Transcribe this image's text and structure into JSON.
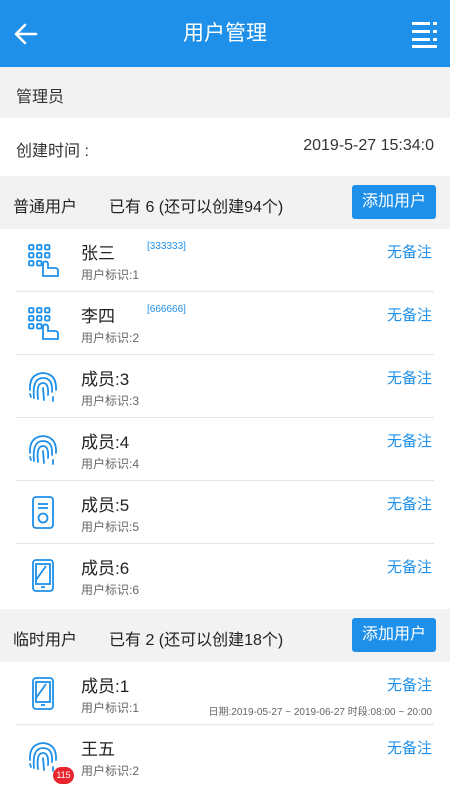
{
  "header": {
    "title": "用户管理",
    "back_icon": "arrow-left-icon",
    "menu_icon": "list-menu-icon"
  },
  "admin": {
    "label": "管理员"
  },
  "creation": {
    "label": "创建时间 :",
    "value": "2019-5-27 15:34:0"
  },
  "regular": {
    "title": "普通用户",
    "count_text": "已有 6 (还可以创建94个)",
    "add_label": "添加用户",
    "users": [
      {
        "name": "张三",
        "code": "[333333]",
        "uid": "用户标识:1",
        "note": "无备注",
        "icon": "keypad-icon"
      },
      {
        "name": "李四",
        "code": "[666666]",
        "uid": "用户标识:2",
        "note": "无备注",
        "icon": "keypad-icon"
      },
      {
        "name": "成员:3",
        "code": "",
        "uid": "用户标识:3",
        "note": "无备注",
        "icon": "fingerprint-icon"
      },
      {
        "name": "成员:4",
        "code": "",
        "uid": "用户标识:4",
        "note": "无备注",
        "icon": "fingerprint-icon"
      },
      {
        "name": "成员:5",
        "code": "",
        "uid": "用户标识:5",
        "note": "无备注",
        "icon": "card-icon"
      },
      {
        "name": "成员:6",
        "code": "",
        "uid": "用户标识:6",
        "note": "无备注",
        "icon": "phone-icon"
      }
    ]
  },
  "temporary": {
    "title": "临时用户",
    "count_text": "已有 2 (还可以创建18个)",
    "add_label": "添加用户",
    "users": [
      {
        "name": "成员:1",
        "uid": "用户标识:1",
        "note": "无备注",
        "period": "日期:2019-05-27 ~ 2019-06-27 时段:08:00 ~ 20:00",
        "icon": "phone-icon"
      },
      {
        "name": "王五",
        "uid": "用户标识:2",
        "note": "无备注",
        "badge": "115",
        "icon": "fingerprint-icon"
      }
    ]
  },
  "colors": {
    "accent": "#1e90ea",
    "badge": "#e8242c"
  }
}
